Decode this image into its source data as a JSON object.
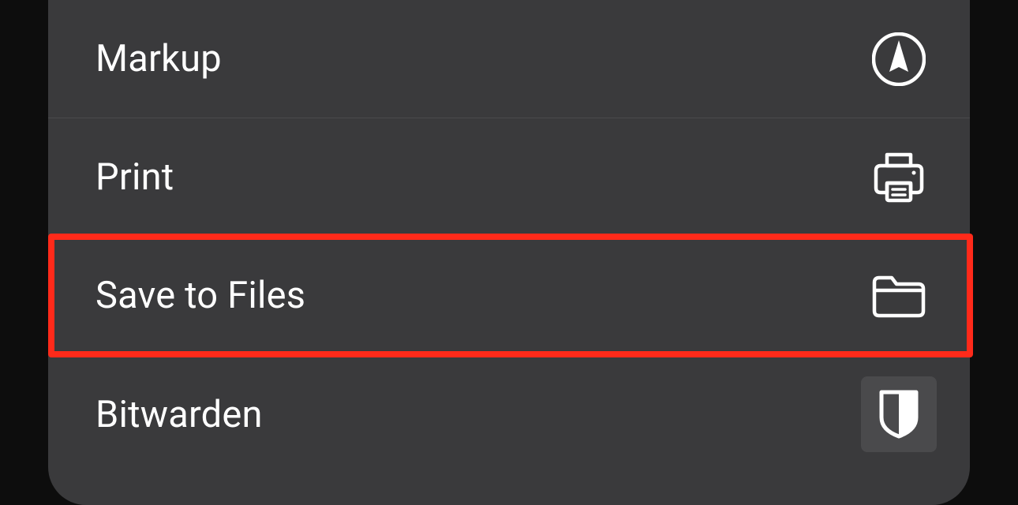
{
  "menu": {
    "items": [
      {
        "label": "Markup",
        "icon": "markup-icon",
        "highlighted": false
      },
      {
        "label": "Print",
        "icon": "print-icon",
        "highlighted": false
      },
      {
        "label": "Save to Files",
        "icon": "folder-icon",
        "highlighted": true
      },
      {
        "label": "Bitwarden",
        "icon": "bitwarden-shield-icon",
        "highlighted": false
      }
    ]
  }
}
